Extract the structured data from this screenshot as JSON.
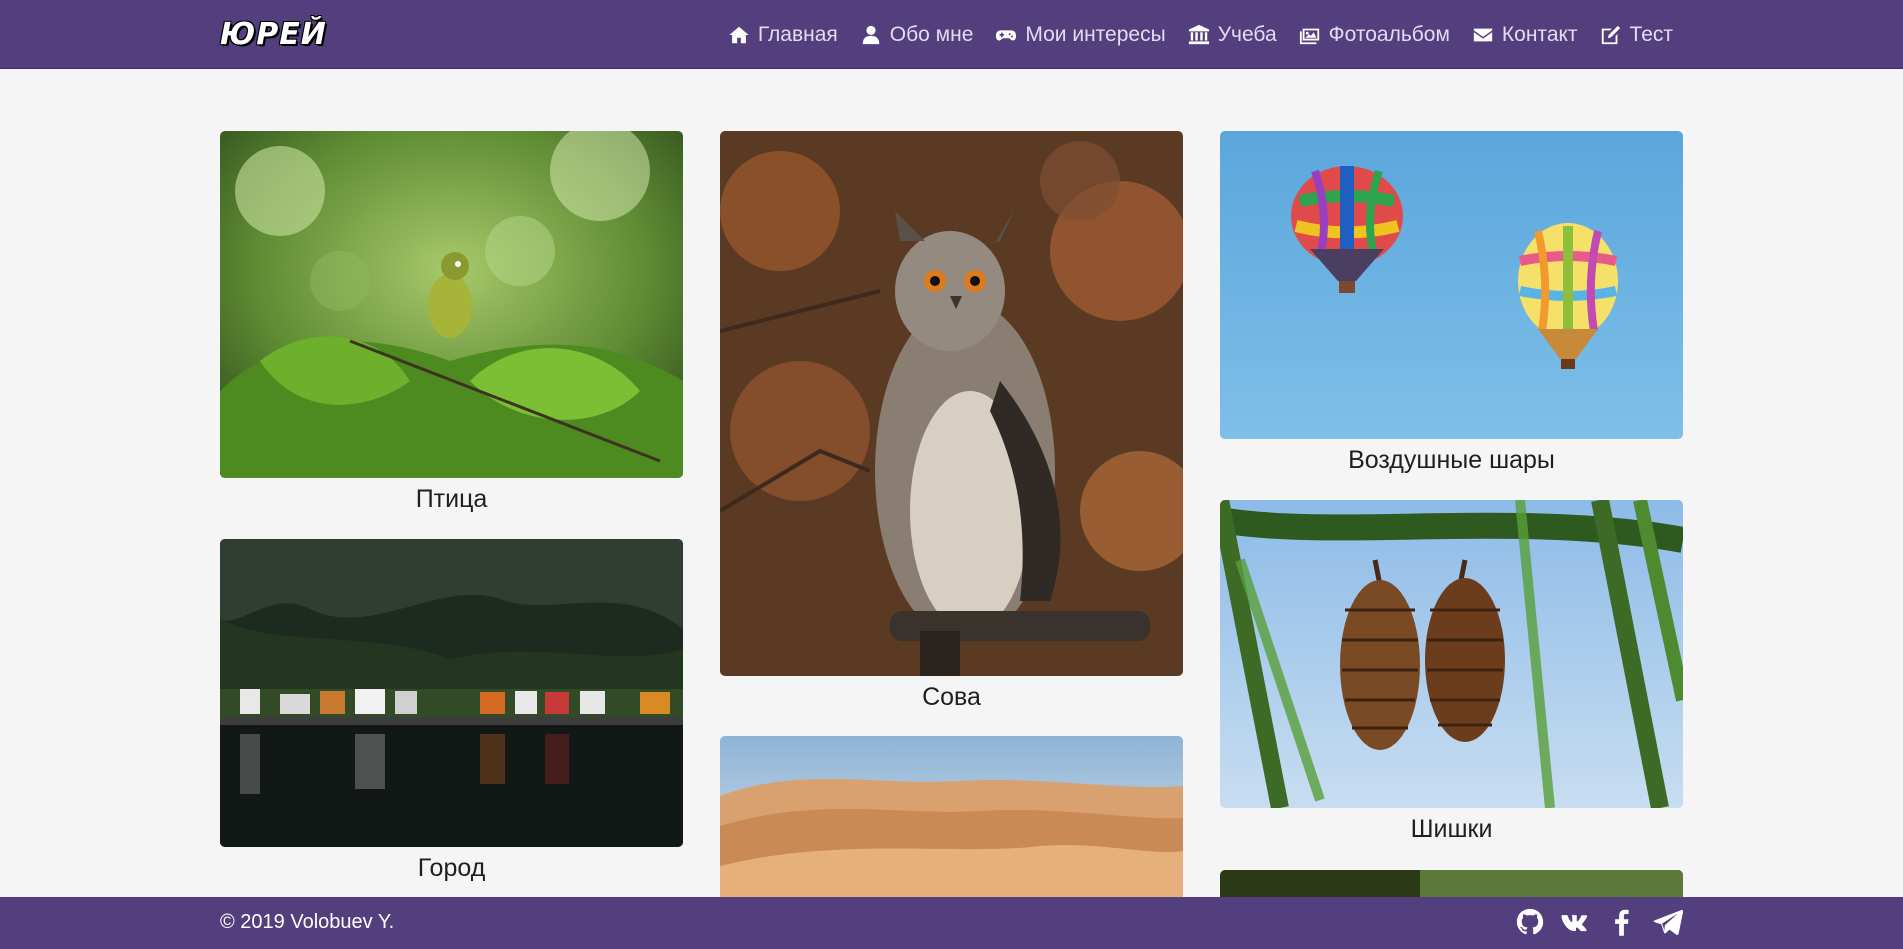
{
  "brand": "ЮРЕЙ",
  "nav": {
    "items": [
      {
        "label": "Главная",
        "icon": "home-icon"
      },
      {
        "label": "Обо мне",
        "icon": "user-icon"
      },
      {
        "label": "Мои интересы",
        "icon": "gamepad-icon"
      },
      {
        "label": "Учеба",
        "icon": "university-icon"
      },
      {
        "label": "Фотоальбом",
        "icon": "images-icon"
      },
      {
        "label": "Контакт",
        "icon": "envelope-icon"
      },
      {
        "label": "Тест",
        "icon": "edit-icon"
      }
    ]
  },
  "gallery": {
    "photos": [
      {
        "caption": "Птица"
      },
      {
        "caption": "Город"
      },
      {
        "caption": "Сова"
      },
      {
        "caption": "Воздушные шары"
      },
      {
        "caption": "Шишки"
      }
    ]
  },
  "footer": {
    "copyright": "© 2019 Volobuev Y.",
    "social": [
      "github-icon",
      "vk-icon",
      "facebook-icon",
      "telegram-icon"
    ]
  },
  "colors": {
    "header_bg": "#533f7d",
    "page_bg": "#f5f5f5",
    "footer_bg": "#533f7d"
  }
}
